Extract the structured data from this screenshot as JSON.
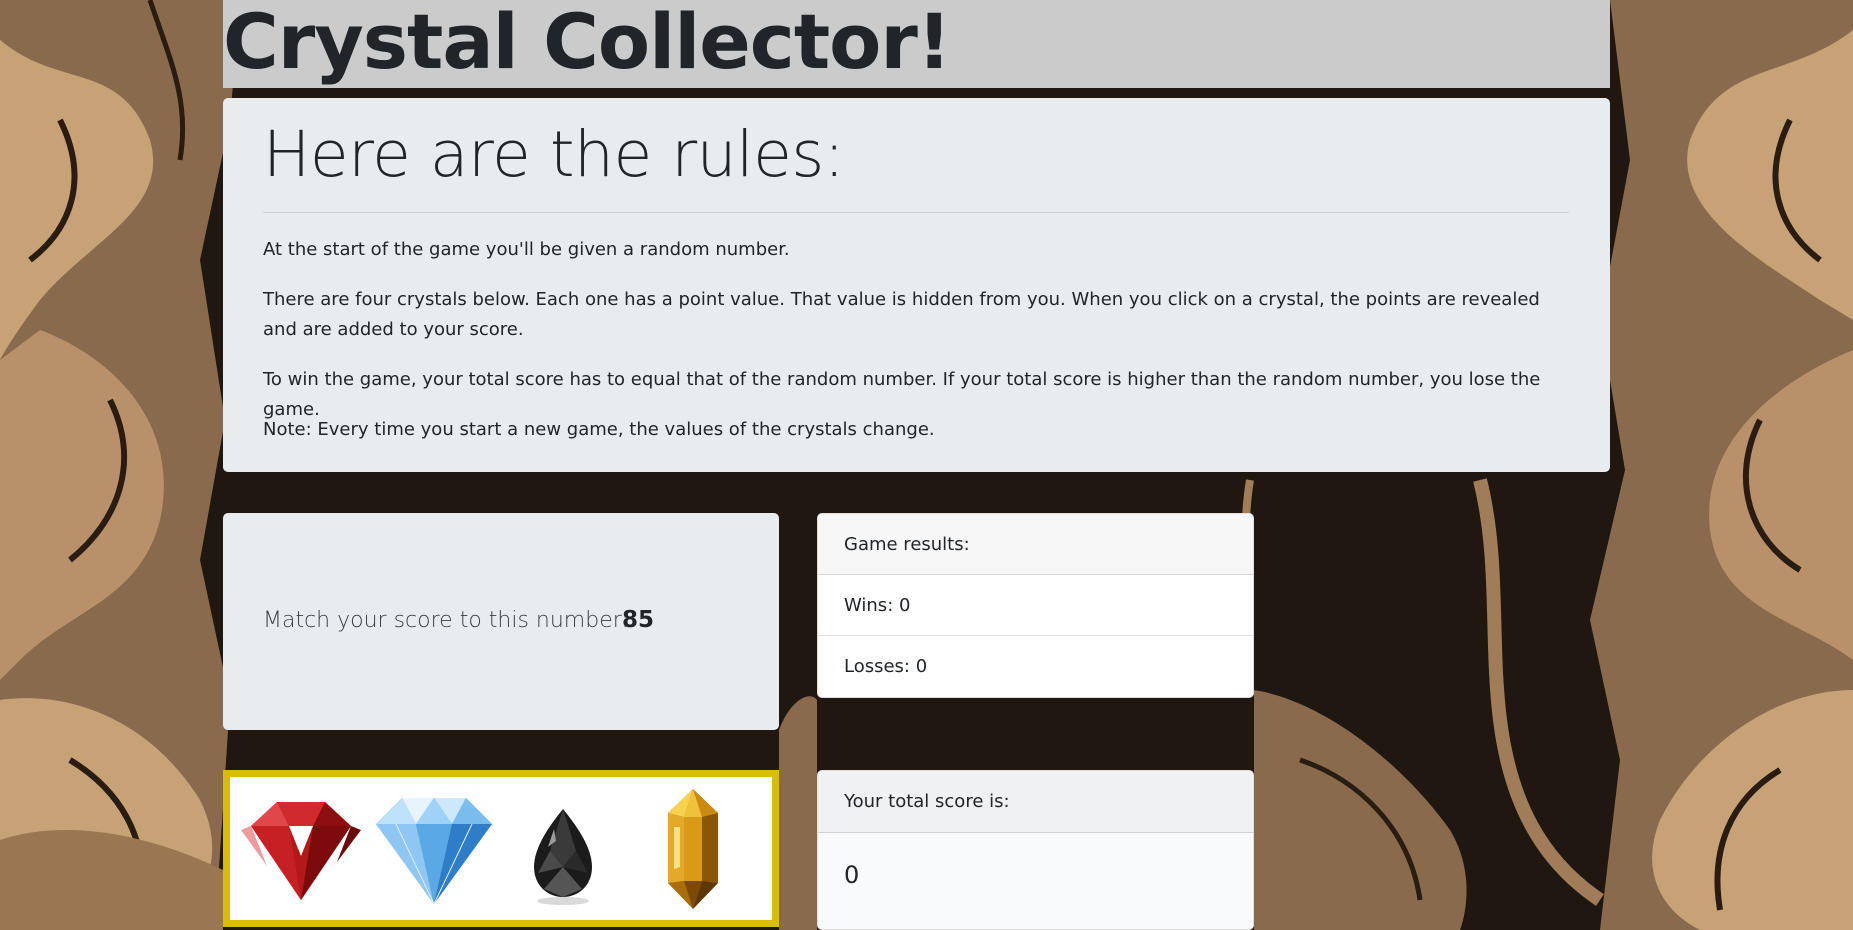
{
  "header": {
    "title": "Crystal Collector!"
  },
  "rules": {
    "heading": "Here are the rules:",
    "paragraphs": [
      "At the start of the game you'll be given a random number.",
      "There are four crystals below. Each one has a point value. That value is hidden from you. When you click on a crystal, the points are revealed and are added to your score.",
      "To win the game, your total score has to equal that of the random number. If your total score is higher than the random number, you lose the game.",
      "Note: Every time you start a new game, the values of the crystals change."
    ]
  },
  "target": {
    "label": "Match your score to this number:",
    "value": "85"
  },
  "results": {
    "header": "Game results:",
    "wins": "Wins: 0",
    "losses": "Losses: 0"
  },
  "total": {
    "header": "Your total score is:",
    "value": "0"
  },
  "crystals": [
    {
      "icon": "red-ruby-icon"
    },
    {
      "icon": "blue-diamond-icon"
    },
    {
      "icon": "black-gem-icon"
    },
    {
      "icon": "amber-crystal-icon"
    }
  ],
  "colors": {
    "frame": "#d9bd00",
    "panel": "#e9ecef",
    "title_bar": "#cbcbcb",
    "background": "#1f1710"
  }
}
